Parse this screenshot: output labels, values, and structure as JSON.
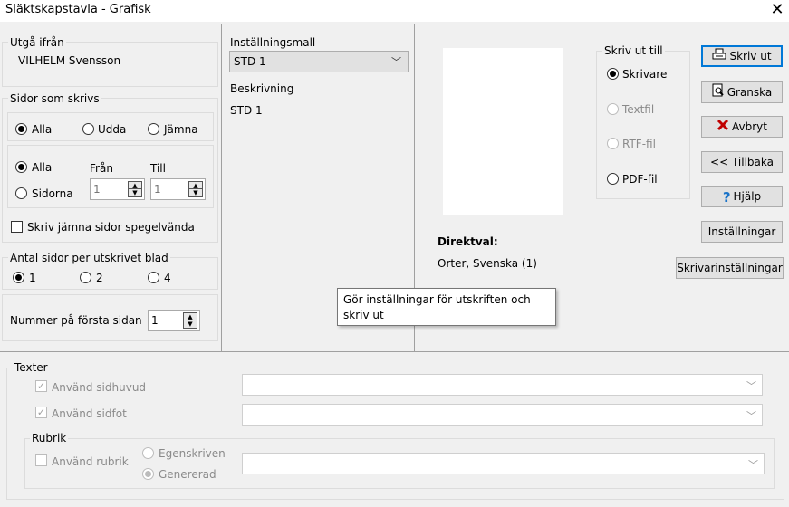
{
  "window": {
    "title": "Släktskapstavla - Grafisk",
    "close_glyph": "✕"
  },
  "left": {
    "start_from": {
      "label": "Utgå ifrån",
      "value": "VILHELM Svensson"
    },
    "pages_printed": {
      "label": "Sidor som skrivs",
      "radios": [
        "Alla",
        "Udda",
        "Jämna"
      ],
      "range_radios": [
        "Alla",
        "Sidorna"
      ],
      "from_label": "Från",
      "to_label": "Till",
      "from_value": "1",
      "to_value": "1",
      "mirror_label": "Skriv jämna sidor spegelvända"
    },
    "pages_per_sheet": {
      "label": "Antal sidor per utskrivet blad",
      "options": [
        "1",
        "2",
        "4"
      ]
    },
    "first_page": {
      "label": "Nummer på första sidan",
      "value": "1"
    }
  },
  "middle": {
    "template_label": "Inställningsmall",
    "template_value": "STD 1",
    "description_label": "Beskrivning",
    "description_value": "STD 1"
  },
  "right": {
    "output_label": "Skriv ut till",
    "outputs": [
      "Skrivare",
      "Textfil",
      "RTF-fil",
      "PDF-fil"
    ],
    "direct_label": "Direktval:",
    "direct_value": "Orter, Svenska (1)"
  },
  "buttons": {
    "print": "Skriv ut",
    "preview": "Granska",
    "cancel": "Avbryt",
    "back": "<< Tillbaka",
    "help": "Hjälp",
    "settings": "Inställningar",
    "printer_settings": "Skrivarinställningar"
  },
  "tooltip": {
    "line1": "Gör inställningar för utskriften och",
    "line2": "skriv ut"
  },
  "texts": {
    "label": "Texter",
    "header_label": "Använd sidhuvud",
    "footer_label": "Använd sidfot",
    "heading_group": "Rubrik",
    "heading_label": "Använd rubrik",
    "custom_label": "Egenskriven",
    "generated_label": "Genererad"
  },
  "colors": {
    "accent": "#0078d7",
    "cancel_red": "#c00000",
    "help_blue": "#1a73c8"
  }
}
